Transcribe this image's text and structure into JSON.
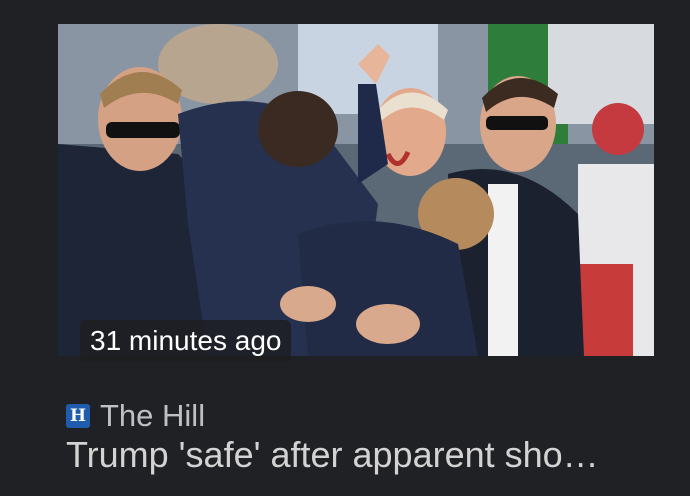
{
  "news_card": {
    "image_alt": "Secret Service agents surrounding Trump at rally",
    "time_ago": "31 minutes ago",
    "source": {
      "logo_letter": "H",
      "name": "The Hill",
      "logo_color": "#1f5cae"
    },
    "headline": "Trump 'safe' after apparent sho…"
  },
  "colors": {
    "background": "#202124",
    "source_text": "#bdc1c6",
    "headline_text": "#d3d3d3"
  }
}
